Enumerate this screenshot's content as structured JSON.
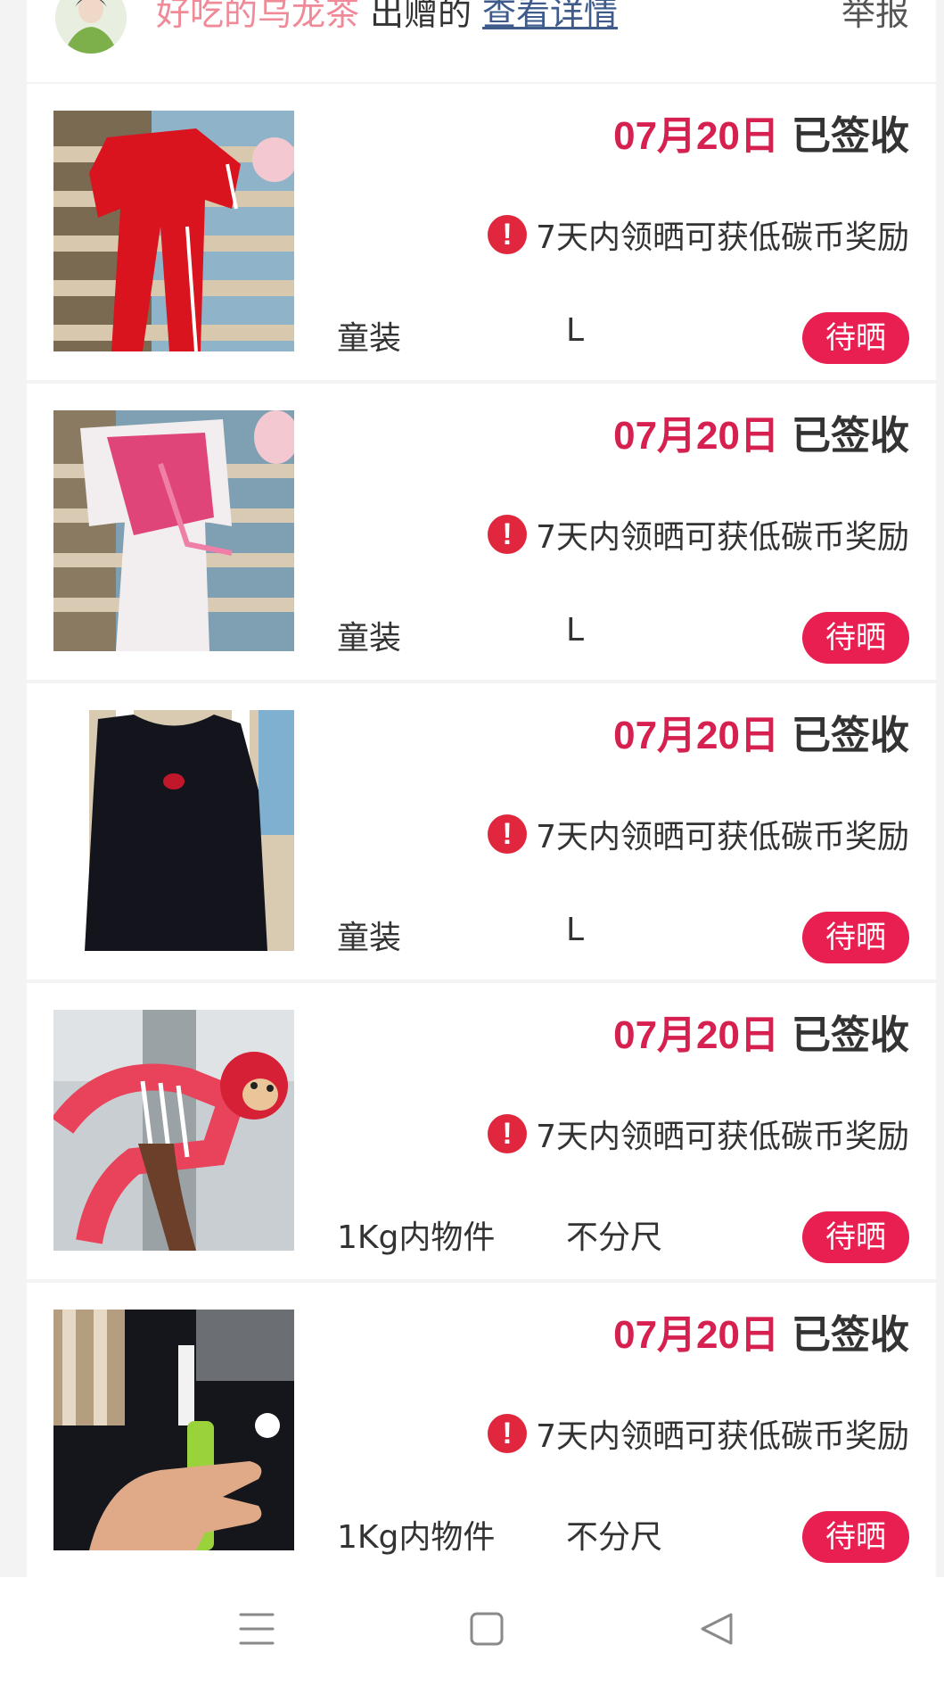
{
  "header": {
    "giver_name": "好吃的乌龙茶",
    "giver_suffix": "出赠的",
    "detail_link": "查看详情",
    "report_link": "举报"
  },
  "items": [
    {
      "date": "07月20日",
      "status": "已签收",
      "notice_icon": "exclamation-circle-icon",
      "notice": "7天内领晒可获低碳币奖励",
      "category": "童装",
      "size": "L",
      "action": "待晒",
      "photo": "red tracksuit photo"
    },
    {
      "date": "07月20日",
      "status": "已签收",
      "notice_icon": "exclamation-circle-icon",
      "notice": "7天内领晒可获低碳币奖励",
      "category": "童装",
      "size": "L",
      "action": "待晒",
      "photo": "pink and white outfit photo"
    },
    {
      "date": "07月20日",
      "status": "已签收",
      "notice_icon": "exclamation-circle-icon",
      "notice": "7天内领晒可获低碳币奖励",
      "category": "童装",
      "size": "L",
      "action": "待晒",
      "photo": "black dress photo"
    },
    {
      "date": "07月20日",
      "status": "已签收",
      "notice_icon": "exclamation-circle-icon",
      "notice": "7天内领晒可获低碳币奖励",
      "category": "1Kg内物件",
      "size": "不分尺",
      "action": "待晒",
      "photo": "red monkey plush photo"
    },
    {
      "date": "07月20日",
      "status": "已签收",
      "notice_icon": "exclamation-circle-icon",
      "notice": "7天内领晒可获低碳币奖励",
      "category": "1Kg内物件",
      "size": "不分尺",
      "action": "待晒",
      "photo": "green selfie stick photo"
    }
  ],
  "nav": {
    "menu_icon": "menu-icon",
    "home_icon": "home-square-icon",
    "back_icon": "back-triangle-icon"
  },
  "colors": {
    "accent": "#e81f50",
    "date": "#d6204f",
    "alert": "#e0273e",
    "giver_name": "#f08a98",
    "link": "#3e5b8c"
  }
}
